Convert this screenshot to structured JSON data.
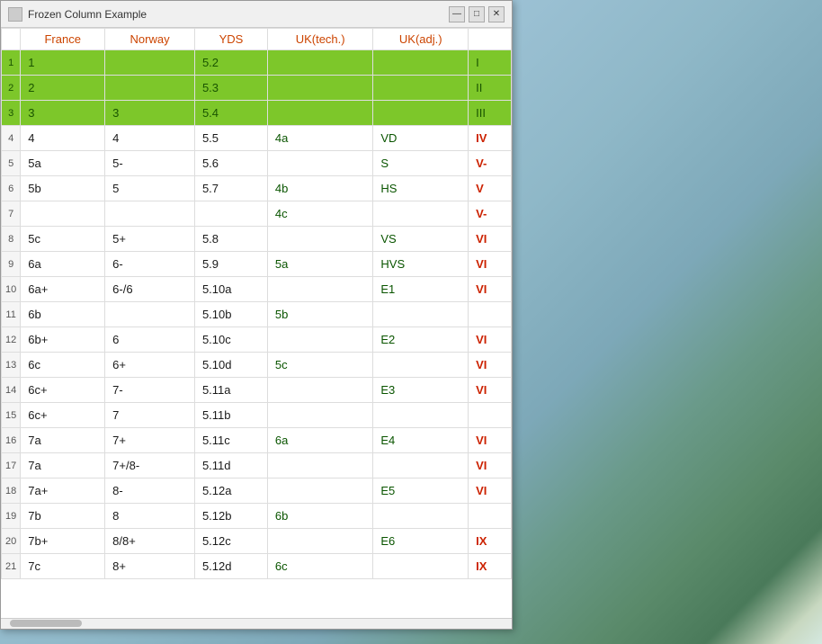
{
  "window": {
    "title": "Frozen Column Example",
    "icon": "table-icon"
  },
  "titlebar": {
    "minimize": "—",
    "maximize": "□",
    "close": "✕"
  },
  "table": {
    "headers": [
      "",
      "France",
      "Norway",
      "YDS",
      "UK(tech.)",
      "UK(adj.)",
      ""
    ],
    "rows": [
      {
        "num": "1",
        "france": "1",
        "norway": "",
        "yds": "5.2",
        "uk_tech": "",
        "uk_adj": "",
        "uiaa": "I",
        "green": true
      },
      {
        "num": "2",
        "france": "2",
        "norway": "",
        "yds": "5.3",
        "uk_tech": "",
        "uk_adj": "",
        "uiaa": "II",
        "green": true
      },
      {
        "num": "3",
        "france": "3",
        "norway": "3",
        "yds": "5.4",
        "uk_tech": "",
        "uk_adj": "",
        "uiaa": "III",
        "green": true
      },
      {
        "num": "4",
        "france": "4",
        "norway": "4",
        "yds": "5.5",
        "uk_tech": "4a",
        "uk_adj": "VD",
        "uiaa": "IV",
        "green": false
      },
      {
        "num": "5",
        "france": "5a",
        "norway": "5-",
        "yds": "5.6",
        "uk_tech": "",
        "uk_adj": "S",
        "uiaa": "V-",
        "green": false
      },
      {
        "num": "6",
        "france": "5b",
        "norway": "5",
        "yds": "5.7",
        "uk_tech": "4b",
        "uk_adj": "HS",
        "uiaa": "V",
        "green": false
      },
      {
        "num": "7",
        "france": "",
        "norway": "",
        "yds": "",
        "uk_tech": "4c",
        "uk_adj": "",
        "uiaa": "V-",
        "green": false
      },
      {
        "num": "8",
        "france": "5c",
        "norway": "5+",
        "yds": "5.8",
        "uk_tech": "",
        "uk_adj": "VS",
        "uiaa": "VI",
        "green": false
      },
      {
        "num": "9",
        "france": "6a",
        "norway": "6-",
        "yds": "5.9",
        "uk_tech": "5a",
        "uk_adj": "HVS",
        "uiaa": "VI",
        "green": false
      },
      {
        "num": "10",
        "france": "6a+",
        "norway": "6-/6",
        "yds": "5.10a",
        "uk_tech": "",
        "uk_adj": "E1",
        "uiaa": "VI",
        "green": false
      },
      {
        "num": "11",
        "france": "6b",
        "norway": "",
        "yds": "5.10b",
        "uk_tech": "5b",
        "uk_adj": "",
        "uiaa": "",
        "green": false
      },
      {
        "num": "12",
        "france": "6b+",
        "norway": "6",
        "yds": "5.10c",
        "uk_tech": "",
        "uk_adj": "E2",
        "uiaa": "VI",
        "green": false
      },
      {
        "num": "13",
        "france": "6c",
        "norway": "6+",
        "yds": "5.10d",
        "uk_tech": "5c",
        "uk_adj": "",
        "uiaa": "VI",
        "green": false
      },
      {
        "num": "14",
        "france": "6c+",
        "norway": "7-",
        "yds": "5.11a",
        "uk_tech": "",
        "uk_adj": "E3",
        "uiaa": "VI",
        "green": false
      },
      {
        "num": "15",
        "france": "6c+",
        "norway": "7",
        "yds": "5.11b",
        "uk_tech": "",
        "uk_adj": "",
        "uiaa": "",
        "green": false
      },
      {
        "num": "16",
        "france": "7a",
        "norway": "7+",
        "yds": "5.11c",
        "uk_tech": "6a",
        "uk_adj": "E4",
        "uiaa": "VI",
        "green": false
      },
      {
        "num": "17",
        "france": "7a",
        "norway": "7+/8-",
        "yds": "5.11d",
        "uk_tech": "",
        "uk_adj": "",
        "uiaa": "VI",
        "green": false
      },
      {
        "num": "18",
        "france": "7a+",
        "norway": "8-",
        "yds": "5.12a",
        "uk_tech": "",
        "uk_adj": "E5",
        "uiaa": "VI",
        "green": false
      },
      {
        "num": "19",
        "france": "7b",
        "norway": "8",
        "yds": "5.12b",
        "uk_tech": "6b",
        "uk_adj": "",
        "uiaa": "",
        "green": false
      },
      {
        "num": "20",
        "france": "7b+",
        "norway": "8/8+",
        "yds": "5.12c",
        "uk_tech": "",
        "uk_adj": "E6",
        "uiaa": "IX",
        "green": false
      },
      {
        "num": "21",
        "france": "7c",
        "norway": "8+",
        "yds": "5.12d",
        "uk_tech": "6c",
        "uk_adj": "",
        "uiaa": "IX",
        "green": false
      }
    ]
  }
}
